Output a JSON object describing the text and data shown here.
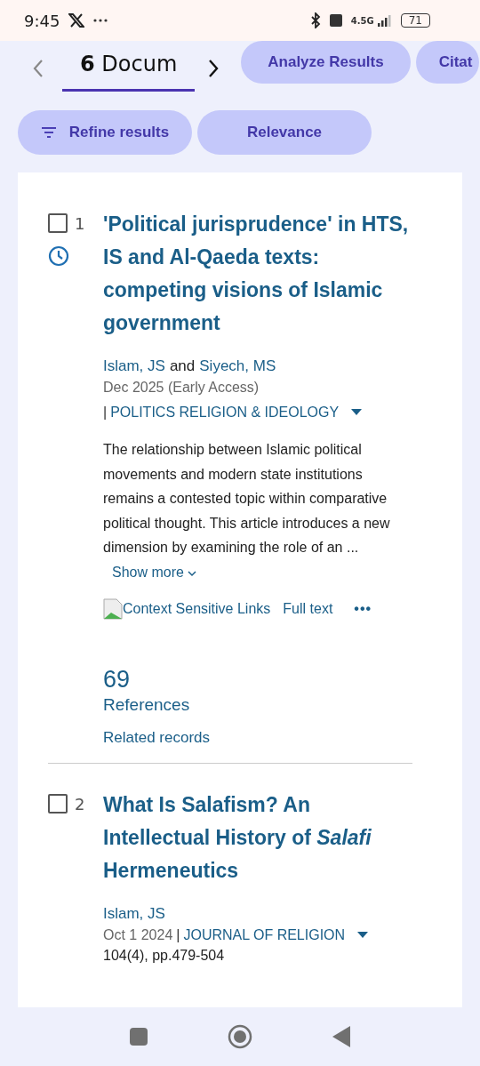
{
  "status_bar": {
    "time": "9:45",
    "network": "4.5G",
    "battery": "71"
  },
  "toolbar": {
    "tab": {
      "count": "6",
      "label": "Docum",
      "selected": true
    },
    "actions": [
      "Analyze Results",
      "Citat"
    ]
  },
  "filters": [
    {
      "label": "Refine results",
      "kind": "filter"
    },
    {
      "label": "Relevance",
      "kind": "sort"
    }
  ],
  "results": [
    {
      "number": "1",
      "checked": false,
      "recent": true,
      "title": "'Political jurisprudence' in HTS, IS and Al-Qaeda texts: competing visions of Islamic government",
      "authors": [
        "Islam, JS",
        "Siyech, MS"
      ],
      "author_joiner": "and",
      "date": "Dec 2025 (Early Access)",
      "separator": "|",
      "journal": "POLITICS RELIGION & IDEOLOGY",
      "abstract": "The relationship between Islamic political movements and modern state institutions remains a contested topic within comparative political thought. This article introduces a new dimension by examining the role of an ...",
      "show_more": "Show more",
      "link_image": "Context Sensitive Links",
      "full_text": "Full text",
      "more": "•••",
      "citations": "69",
      "citations_label": "References",
      "related": "Related records"
    },
    {
      "number": "2",
      "checked": false,
      "recent": false,
      "title": "What Is Salafism? An Intellectual History of *Salafi* Hermeneutics",
      "authors": [
        "Islam, JS"
      ],
      "date": "Oct 1 2024",
      "separator": "|",
      "journal": "JOURNAL OF RELIGION",
      "pages": "104(4), pp.479-504"
    }
  ]
}
